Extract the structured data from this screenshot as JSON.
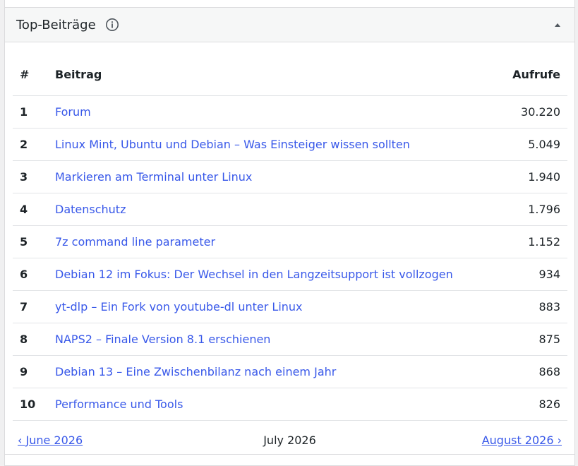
{
  "widget": {
    "title": "Top-Beiträge",
    "info_icon": "info-icon",
    "toggle_icon": "triangle-up-icon"
  },
  "table": {
    "headers": {
      "rank": "#",
      "post": "Beitrag",
      "views": "Aufrufe"
    },
    "rows": [
      {
        "rank": "1",
        "title": "Forum",
        "views": "30.220"
      },
      {
        "rank": "2",
        "title": "Linux Mint, Ubuntu und Debian – Was Einsteiger wissen sollten",
        "views": "5.049"
      },
      {
        "rank": "3",
        "title": "Markieren am Terminal unter Linux",
        "views": "1.940"
      },
      {
        "rank": "4",
        "title": "Datenschutz",
        "views": "1.796"
      },
      {
        "rank": "5",
        "title": "7z command line parameter",
        "views": "1.152"
      },
      {
        "rank": "6",
        "title": "Debian 12 im Fokus: Der Wechsel in den Langzeitsupport ist vollzogen",
        "views": "934"
      },
      {
        "rank": "7",
        "title": "yt-dlp – Ein Fork von youtube-dl unter Linux",
        "views": "883"
      },
      {
        "rank": "8",
        "title": "NAPS2 – Finale Version 8.1 erschienen",
        "views": "875"
      },
      {
        "rank": "9",
        "title": "Debian 13 – Eine Zwischenbilanz nach einem Jahr",
        "views": "868"
      },
      {
        "rank": "10",
        "title": "Performance und Tools",
        "views": "826"
      }
    ]
  },
  "pager": {
    "prev": "‹ June 2026",
    "current": "July 2026",
    "next": "August 2026 ›"
  },
  "colors": {
    "link": "#3858e9",
    "text": "#1d2327",
    "border": "#dcdcde"
  }
}
